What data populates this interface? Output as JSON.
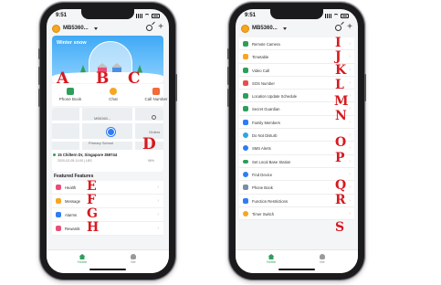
{
  "status": {
    "time": "9:51"
  },
  "app": {
    "device_name": "MB5360...",
    "accent": "#2e9e5b"
  },
  "home": {
    "banner_title": "Winter snow",
    "shortcuts": [
      {
        "label": "Phone Book",
        "icon": "phone-book-icon",
        "color": "#2e9e5b"
      },
      {
        "label": "Chat",
        "icon": "chat-icon",
        "color": "#f5a623"
      },
      {
        "label": "Call Number",
        "icon": "call-icon",
        "color": "#f26b3a"
      }
    ],
    "map": {
      "label_top": "MB5360...",
      "label_school": "Primary School",
      "label_right": "Orders",
      "address": "15 Chiltern Dr, Singapore 359744",
      "address_sub": "2020-02-05 11:00 | LBS",
      "battery": "96%"
    },
    "featured_title": "Featured Features",
    "featured": [
      {
        "label": "Health",
        "icon": "heart-icon",
        "color": "#e94e77"
      },
      {
        "label": "Message",
        "icon": "message-icon",
        "color": "#f5a623"
      },
      {
        "label": "Alarms",
        "icon": "alarm-icon",
        "color": "#2f7cf6"
      },
      {
        "label": "Rewards",
        "icon": "reward-icon",
        "color": "#e94e77"
      }
    ]
  },
  "tabs": [
    {
      "label": "Home"
    },
    {
      "label": "Me"
    }
  ],
  "functions": [
    {
      "label": "Remote Camera",
      "icon": "camera-icon",
      "color": "#2e9e5b"
    },
    {
      "label": "Timetable",
      "icon": "timetable-icon",
      "color": "#f5a623"
    },
    {
      "label": "Video Call",
      "icon": "video-call-icon",
      "color": "#2e9e5b"
    },
    {
      "label": "SOS Number",
      "icon": "sos-icon",
      "color": "#e94e4e"
    },
    {
      "label": "Location Update Schedule",
      "icon": "location-icon",
      "color": "#2e9e5b"
    },
    {
      "label": "Secret Guardian",
      "icon": "shield-icon",
      "color": "#2e9e5b"
    },
    {
      "label": "Family Members",
      "icon": "family-icon",
      "color": "#2f7cf6"
    },
    {
      "label": "Do Not Disturb",
      "icon": "dnd-icon",
      "color": "#29a8e0"
    },
    {
      "label": "SMS Alerts",
      "icon": "sms-icon",
      "color": "#2f7cf6"
    },
    {
      "label": "Set Local Base Station",
      "icon": "toggle-icon",
      "color": "#2e9e5b"
    },
    {
      "label": "Find Device",
      "icon": "find-device-icon",
      "color": "#2f7cf6"
    },
    {
      "label": "Phone Book",
      "icon": "phone-book-icon",
      "color": "#7b8ca6"
    },
    {
      "label": "Function Restrictions",
      "icon": "restrictions-icon",
      "color": "#2f7cf6"
    },
    {
      "label": "Timer Switch",
      "icon": "timer-icon",
      "color": "#f5a623"
    }
  ],
  "callouts": {
    "A": "A",
    "B": "B",
    "C": "C",
    "D": "D",
    "E": "E",
    "F": "F",
    "G": "G",
    "H": "H",
    "I": "I",
    "J": "J",
    "K": "K",
    "L": "L",
    "M": "M",
    "N": "N",
    "O": "O",
    "P": "P",
    "Q": "Q",
    "R": "R",
    "S": "S"
  }
}
